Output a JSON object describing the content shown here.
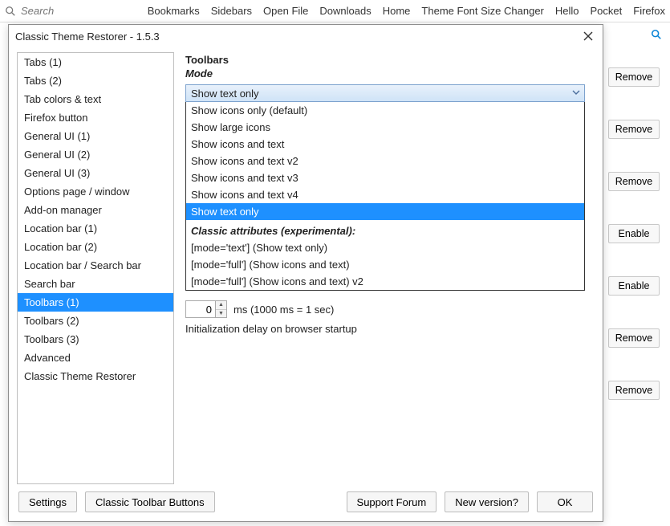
{
  "toolbar": {
    "search_placeholder": "Search",
    "bookmarks": [
      "Bookmarks",
      "Sidebars",
      "Open File",
      "Downloads",
      "Home",
      "Theme Font Size Changer",
      "Hello",
      "Pocket",
      "Firefox"
    ]
  },
  "right_panel": {
    "buttons": [
      "Remove",
      "Remove",
      "Remove",
      "Enable",
      "Enable",
      "Remove",
      "Remove"
    ]
  },
  "dialog": {
    "title": "Classic Theme Restorer - 1.5.3",
    "sidebar": {
      "items": [
        "Tabs (1)",
        "Tabs (2)",
        "Tab colors & text",
        "Firefox button",
        "General UI (1)",
        "General UI (2)",
        "General UI (3)",
        "Options page / window",
        "Add-on manager",
        "Location bar (1)",
        "Location bar (2)",
        "Location bar / Search bar",
        "Search bar",
        "Toolbars (1)",
        "Toolbars (2)",
        "Toolbars (3)",
        "Advanced",
        "Classic Theme Restorer"
      ],
      "selected_index": 13
    },
    "content": {
      "section_title": "Toolbars",
      "mode_label": "Mode",
      "combo_selected": "Show text only",
      "options": [
        "Show icons only (default)",
        "Show large icons",
        "Show icons and text",
        "Show icons and text v2",
        "Show icons and text v3",
        "Show icons and text v4",
        "Show text only"
      ],
      "options_selected_index": 6,
      "classic_header": "Classic attributes (experimental):",
      "classic_options": [
        "[mode='text'] (Show text only)",
        "[mode='full'] (Show icons and text)",
        "[mode='full'] (Show icons and text) v2"
      ],
      "spinner_value": "0",
      "spinner_suffix": "ms (1000 ms = 1 sec)",
      "init_label": "Initialization delay on browser startup"
    },
    "footer": {
      "settings": "Settings",
      "classic_buttons": "Classic Toolbar Buttons",
      "support": "Support Forum",
      "newver": "New version?",
      "ok": "OK"
    }
  }
}
